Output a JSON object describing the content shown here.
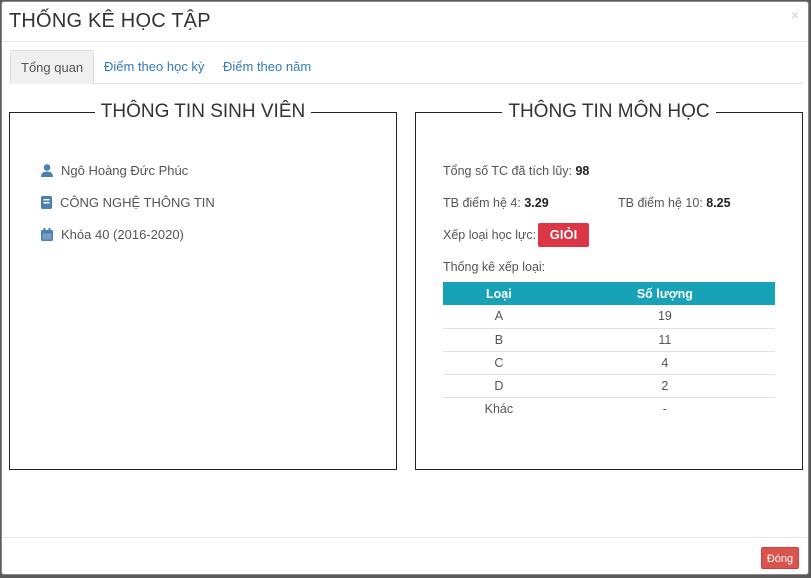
{
  "modal": {
    "title": "THỐNG KÊ HỌC TẬP"
  },
  "tabs": [
    {
      "label": "Tổng quan",
      "active": true
    },
    {
      "label": "Điểm theo học kỳ",
      "active": false
    },
    {
      "label": "Điểm theo năm",
      "active": false
    }
  ],
  "student": {
    "legend": "THÔNG TIN SINH VIÊN",
    "name": "Ngô Hoàng Đức Phúc",
    "major": "CÔNG NGHỆ THÔNG TIN",
    "cohort": "Khóa 40 (2016-2020)"
  },
  "course": {
    "legend": "THÔNG TIN MÔN HỌC",
    "credits_label": "Tổng số TC đã tích lũy:",
    "credits_value": "98",
    "gpa4_label": "TB điểm hệ 4:",
    "gpa4_value": "3.29",
    "gpa10_label": "TB điểm hệ 10:",
    "gpa10_value": "8.25",
    "rank_label": "Xếp loại học lực:",
    "rank_value": "GIỎI",
    "stats_label": "Thống kê xếp loại:",
    "table": {
      "headers": [
        "Loại",
        "Số lượng"
      ],
      "rows": [
        [
          "A",
          "19"
        ],
        [
          "B",
          "11"
        ],
        [
          "C",
          "4"
        ],
        [
          "D",
          "2"
        ],
        [
          "Khác",
          "-"
        ]
      ]
    }
  },
  "footer": {
    "close_label": "Đóng"
  },
  "colors": {
    "accent": "#17a2b8",
    "danger": "#dc3545",
    "link": "#337ab7"
  },
  "icons": [
    "user-icon",
    "book-icon",
    "calendar-icon",
    "close-icon"
  ]
}
